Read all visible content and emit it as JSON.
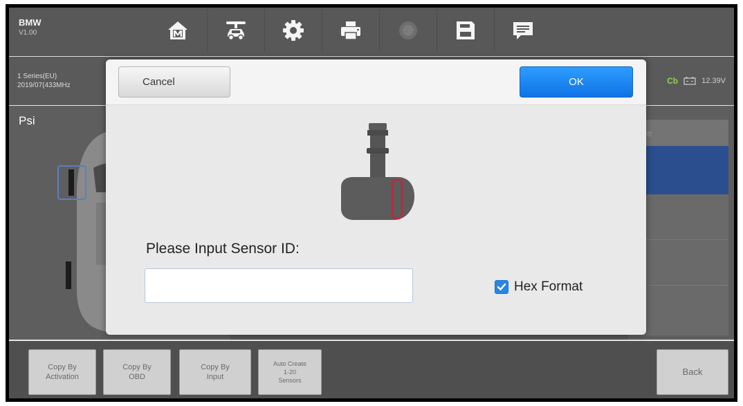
{
  "app": {
    "vehicle_make": "BMW",
    "vehicle_version": "V1.00"
  },
  "toolbar": {
    "icons": [
      "home-icon",
      "vehicle-lift-icon",
      "gear-icon",
      "printer-icon",
      "record-icon",
      "save-icon",
      "message-icon"
    ]
  },
  "info_strip": {
    "model_line1": "1 Series(EU)",
    "model_line2": "2019/07(433MHz",
    "connection_badge": "Cb",
    "battery_voltage": "12.39V"
  },
  "main": {
    "pressure_unit": "Psi",
    "right_panel_header": "de"
  },
  "dialog": {
    "cancel_label": "Cancel",
    "ok_label": "OK",
    "prompt": "Please Input Sensor ID:",
    "sensor_id_value": "",
    "sensor_id_placeholder": "",
    "hex_format_label": "Hex Format",
    "hex_format_checked": true,
    "accent_color": "#1a86f0"
  },
  "bottom_bar": {
    "copy_by_activation": [
      "Copy By",
      "Activation"
    ],
    "copy_by_obd": [
      "Copy By",
      "OBD"
    ],
    "copy_by_input": [
      "Copy By",
      "Input"
    ],
    "auto_create": [
      "Auto Create",
      "1-20",
      "Sensors"
    ],
    "back": "Back"
  }
}
